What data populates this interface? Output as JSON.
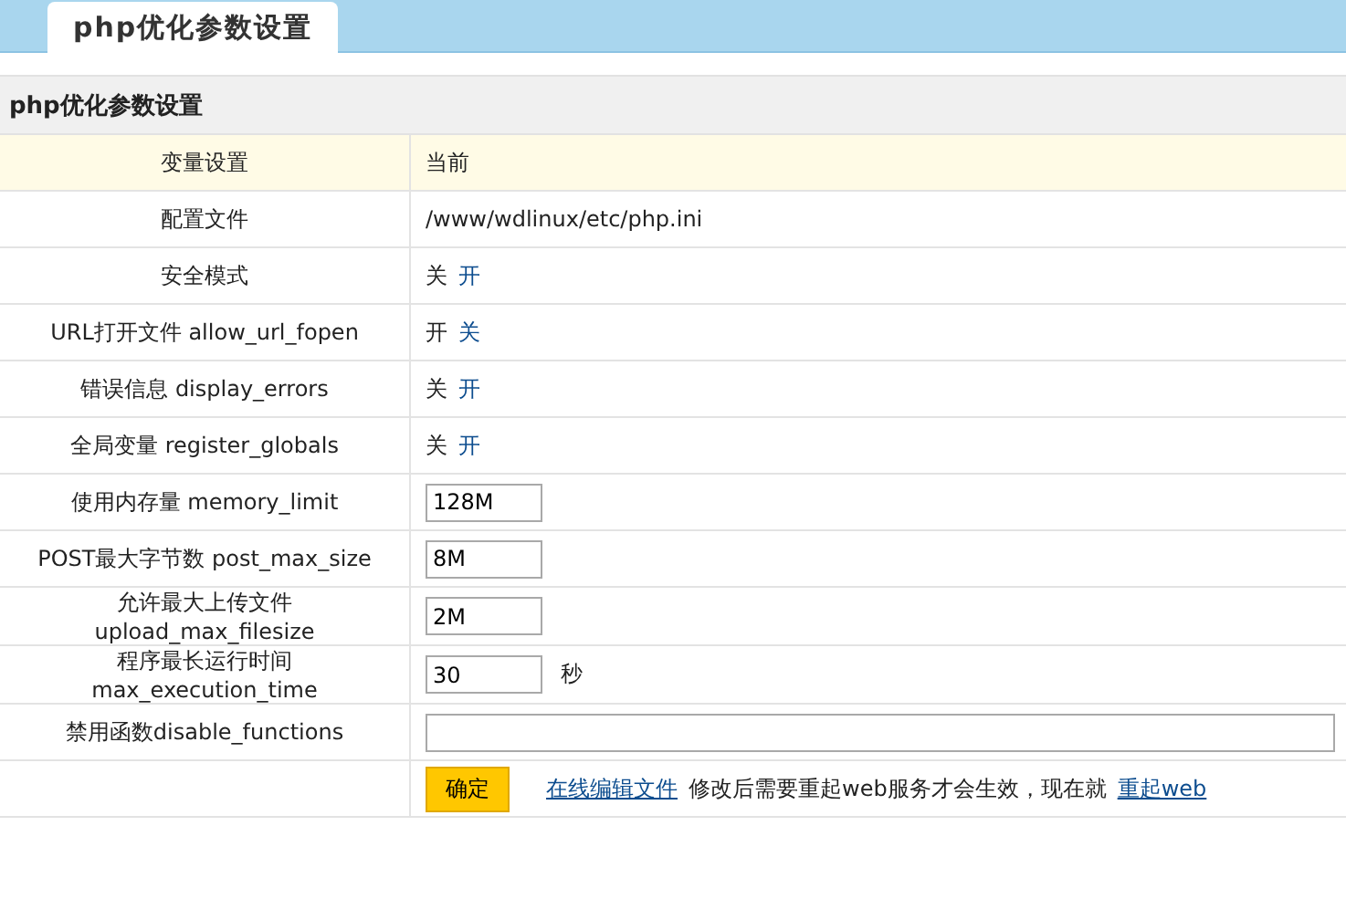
{
  "tabs": [
    {
      "label": "php优化参数设置",
      "selected": true
    }
  ],
  "section_title": "php优化参数设置",
  "header": {
    "label": "变量设置",
    "value": "当前"
  },
  "rows": [
    {
      "kind": "text",
      "label": "配置文件",
      "value": "/www/wdlinux/etc/php.ini"
    },
    {
      "kind": "toggle",
      "label": "安全模式",
      "current": "关",
      "link": "开"
    },
    {
      "kind": "toggle",
      "label": "URL打开文件 allow_url_fopen",
      "current": "开",
      "link": "关"
    },
    {
      "kind": "toggle",
      "label": "错误信息 display_errors",
      "current": "关",
      "link": "开"
    },
    {
      "kind": "toggle",
      "label": "全局变量 register_globals",
      "current": "关",
      "link": "开"
    },
    {
      "kind": "input",
      "label": "使用内存量 memory_limit",
      "value": "128M"
    },
    {
      "kind": "input",
      "label": "POST最大字节数 post_max_size",
      "value": "8M"
    },
    {
      "kind": "input",
      "label": "允许最大上传文件 upload_max_filesize",
      "value": "2M"
    },
    {
      "kind": "input",
      "label": "程序最长运行时间 max_execution_time",
      "value": "30",
      "unit": "秒"
    },
    {
      "kind": "wide",
      "label": "禁用函数disable_functions",
      "value": ""
    }
  ],
  "actions": {
    "button": "确定",
    "edit_link": "在线编辑文件",
    "note": "修改后需要重起web服务才会生效，现在就",
    "restart_link": "重起web"
  }
}
